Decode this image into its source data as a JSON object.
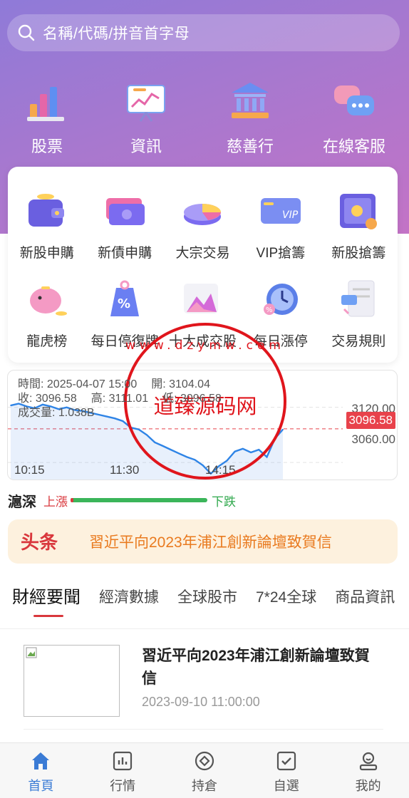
{
  "search": {
    "placeholder": "名稱/代碼/拼音首字母"
  },
  "top_nav": [
    {
      "label": "股票",
      "icon": "bar-chart-icon"
    },
    {
      "label": "資訊",
      "icon": "presentation-board-icon"
    },
    {
      "label": "慈善行",
      "icon": "bank-building-icon"
    },
    {
      "label": "在線客服",
      "icon": "chat-bubbles-icon"
    }
  ],
  "grid": [
    {
      "label": "新股申購",
      "icon": "wallet-icon"
    },
    {
      "label": "新債申購",
      "icon": "cash-stack-icon"
    },
    {
      "label": "大宗交易",
      "icon": "pie-chart-icon"
    },
    {
      "label": "VIP搶籌",
      "icon": "vip-card-icon"
    },
    {
      "label": "新股搶籌",
      "icon": "safe-icon"
    },
    {
      "label": "龍虎榜",
      "icon": "piggy-bank-icon"
    },
    {
      "label": "每日停復牌",
      "icon": "discount-tag-icon"
    },
    {
      "label": "十大成交股",
      "icon": "mountain-chart-icon"
    },
    {
      "label": "每日漲停",
      "icon": "alarm-clock-icon"
    },
    {
      "label": "交易規則",
      "icon": "receipt-icon"
    }
  ],
  "chart_info": {
    "time": "時間: 2025-04-07 15:00",
    "open": "開: 3104.04",
    "close": "收: 3096.58",
    "high": "高: 3111.01",
    "low": "低: 3096.58",
    "volume": "成交量: 1.038B"
  },
  "chart_data": {
    "type": "line",
    "x_ticks": [
      "10:15",
      "11:30",
      "14:15"
    ],
    "y_ticks": [
      "3120.00",
      "3060.00"
    ],
    "current_price": "3096.58",
    "ylim": [
      3040,
      3160
    ],
    "series": [
      {
        "values": [
          3122,
          3124,
          3121,
          3119,
          3123,
          3121,
          3118,
          3120,
          3117,
          3116,
          3114,
          3112,
          3110,
          3108,
          3105,
          3098,
          3096,
          3090,
          3082,
          3078,
          3074,
          3070,
          3066,
          3063,
          3057,
          3048,
          3056,
          3062,
          3072,
          3075,
          3071,
          3074,
          3066,
          3086,
          3096
        ]
      }
    ]
  },
  "market": {
    "name": "滬深",
    "up": "上漲",
    "down": "下跌",
    "up_ratio": 0.02
  },
  "headline": {
    "logo": "头条",
    "text": "習近平向2023年浦江創新論壇致賀信"
  },
  "tabs": [
    "財經要聞",
    "經濟數據",
    "全球股市",
    "7*24全球",
    "商品資訊"
  ],
  "news": [
    {
      "title": "習近平向2023年浦江創新論壇致賀信",
      "time": "2023-09-10 11:00:00"
    }
  ],
  "bottom_nav": [
    {
      "label": "首頁",
      "icon": "home-icon"
    },
    {
      "label": "行情",
      "icon": "market-chart-icon"
    },
    {
      "label": "持倉",
      "icon": "position-icon"
    },
    {
      "label": "自選",
      "icon": "checkbox-icon"
    },
    {
      "label": "我的",
      "icon": "profile-icon"
    }
  ],
  "watermark": {
    "text": "道臻源码网",
    "url_text": "www.dzymw.com"
  },
  "colors": {
    "accent": "#3a7bd5",
    "up": "#d9373c",
    "down": "#2fa84c",
    "headline": "#e97a1f"
  }
}
